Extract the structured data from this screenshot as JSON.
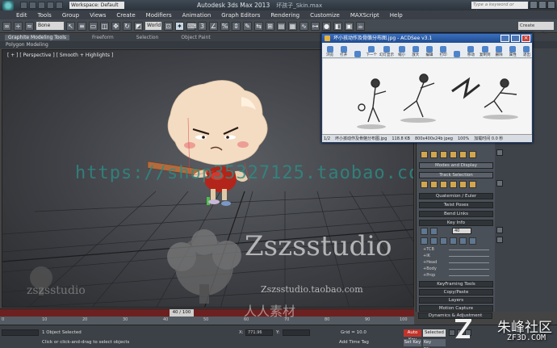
{
  "app": {
    "title": "Autodesk 3ds Max 2013",
    "file": "坏孩子_Skin.max",
    "workspace": "Workspace: Default",
    "search_placeholder": "Type a keyword or phrase"
  },
  "menu": [
    "Edit",
    "Tools",
    "Group",
    "Views",
    "Create",
    "Modifiers",
    "Animation",
    "Graph Editors",
    "Rendering",
    "Customize",
    "MAXScript",
    "Help"
  ],
  "toolbar": {
    "filter": "Bone",
    "coord": "World",
    "named_selection": "Create Selection Se"
  },
  "ribbon": {
    "tabs": [
      "Graphite Modeling Tools",
      "Freeform",
      "Selection",
      "Object Paint"
    ],
    "sub": "Polygon Modeling"
  },
  "viewport": {
    "label": "[ + ] [ Perspective ] [ Smooth + Highlights ]"
  },
  "watermarks": {
    "shop": "https://shop35327125.taobao.com",
    "brand": "Zszsstudio",
    "brand_url": "Zszsstudio.taobao.com",
    "brand_small": "zszsstudio",
    "ren": "人人素材",
    "corner_cn": "朱峰社区",
    "corner_url": "ZF3D.COM"
  },
  "acdsee": {
    "title": "坏小孩动作及骨骼分布图.jpg - ACDSee v3.1",
    "tools": [
      "浏览",
      "打开",
      "",
      "下一个",
      "幻灯显示",
      "缩小",
      "放大",
      "编辑",
      "打印",
      "",
      "移动",
      "复制到",
      "删除",
      "属性",
      "退出"
    ],
    "status": {
      "index": "1/2",
      "name": "坏小孩动作及骨骼分布图.jpg",
      "size": "118.8 KB",
      "dims": "800x400x24b jpeg",
      "zoom": "100%",
      "load": "加载时间 0.0 秒"
    }
  },
  "command_panel": {
    "rollouts": [
      "Modes and Display",
      "Track Selection",
      "Quaternion / Euler",
      "Twist Poses",
      "Bend Links",
      "Key Info",
      "KeyFraming Tools",
      "Copy/Paste",
      "Layers",
      "Motion Capture",
      "Dynamics & Adjustment"
    ],
    "keyinfo_frame": "40",
    "keyinfo_rows": [
      "+TCB",
      "+IK",
      "+Head",
      "+Body",
      "+Prop"
    ]
  },
  "timeline": {
    "position": "40 / 100",
    "ticks": [
      "0",
      "10",
      "20",
      "30",
      "40",
      "50",
      "60",
      "70",
      "80",
      "90",
      "100"
    ]
  },
  "status": {
    "selected_count": "1 Object Selected",
    "prompt": "Click or click-and-drag to select objects",
    "x_label": "X:",
    "x_value": "771.96",
    "y_label": "Y:",
    "grid": "Grid = 10.0",
    "add_time_tag": "Add Time Tag",
    "auto_key": "Auto Key",
    "selected": "Selected",
    "set_key": "Set Key",
    "key_filters": "Key Filters..."
  }
}
